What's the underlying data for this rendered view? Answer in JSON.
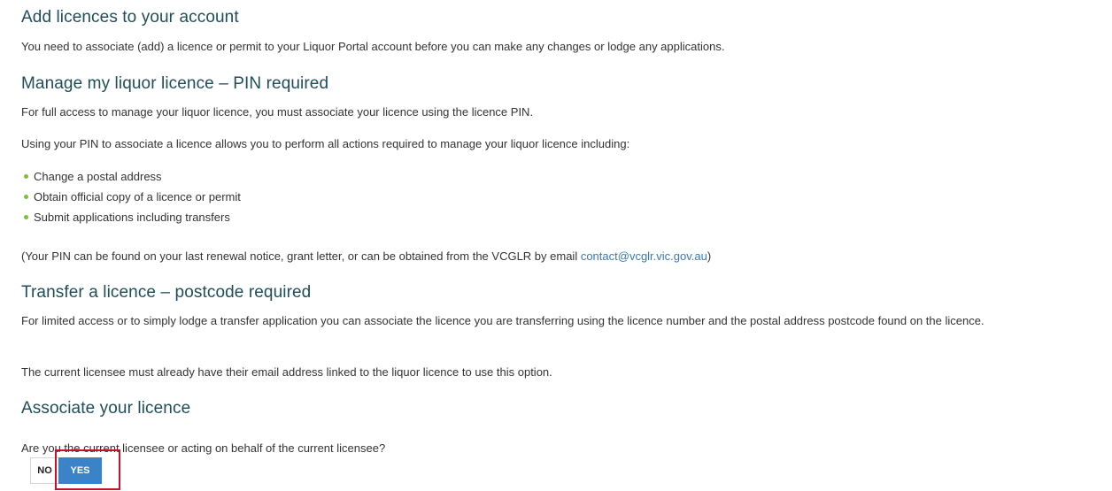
{
  "add_section": {
    "heading": "Add licences to your account",
    "text": "You need to associate (add) a licence or permit to your Liquor Portal account before you can make any changes or lodge any applications."
  },
  "manage_section": {
    "heading": "Manage my liquor licence – PIN required",
    "text1": "For full access to manage your liquor licence, you must associate your licence using the licence PIN.",
    "text2": "Using your PIN to associate a licence allows you to perform all actions required to manage your liquor licence including:",
    "bullets": [
      "Change a postal address",
      "Obtain official copy of a licence or permit",
      "Submit applications including transfers"
    ],
    "pin_note_prefix": "(Your PIN can be found on your last renewal notice, grant letter, or can be obtained from the VCGLR by email ",
    "pin_note_email": "contact@vcglr.vic.gov.au",
    "pin_note_suffix": ")"
  },
  "transfer_section": {
    "heading": "Transfer a licence – postcode required",
    "text1": "For limited access or to simply lodge a transfer application you can associate the licence you are transferring using the licence number and the postal address postcode found on the licence.",
    "text2": "The current licensee must already have their email address linked to the liquor licence to use this option."
  },
  "associate_section": {
    "heading": "Associate your licence",
    "question": "Are you the current licensee or acting on behalf of the current licensee?",
    "no_label": "NO",
    "yes_label": "YES",
    "selected": "YES"
  },
  "colors": {
    "heading": "#1e4e5a",
    "link": "#3a78b5",
    "bullet": "#7bbf3a",
    "yes_button": "#3b83c8",
    "highlight": "#c8102e"
  }
}
